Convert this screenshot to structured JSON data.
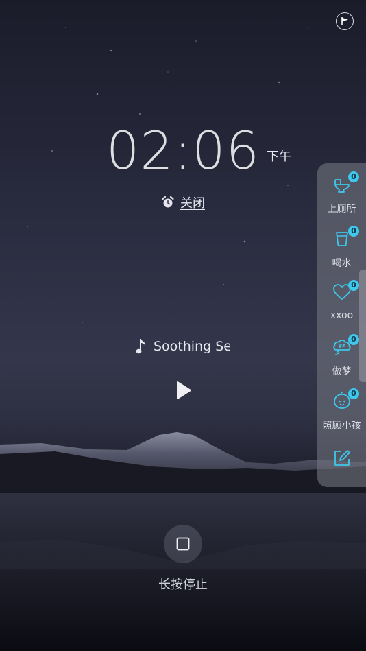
{
  "clock": {
    "time": "02:06",
    "ampm": "下午"
  },
  "alarm": {
    "label": "关闭",
    "icon": "alarm-clock-icon"
  },
  "music": {
    "icon": "music-note-icon",
    "title": "Soothing Sea"
  },
  "player": {
    "play_icon": "play-icon"
  },
  "stop": {
    "icon": "square-stop-icon",
    "label": "长按停止"
  },
  "top": {
    "icon": "flag-icon"
  },
  "sidebar": {
    "accent_color": "#3fc8ec",
    "items": [
      {
        "label": "上厕所",
        "count": "0",
        "icon": "toilet-icon"
      },
      {
        "label": "喝水",
        "count": "0",
        "icon": "cup-icon"
      },
      {
        "label": "xxoo",
        "count": "0",
        "icon": "heart-icon"
      },
      {
        "label": "做梦",
        "count": "0",
        "icon": "dream-cloud-icon"
      },
      {
        "label": "照顾小孩",
        "count": "0",
        "icon": "baby-face-icon"
      }
    ],
    "edit_icon": "edit-icon"
  }
}
